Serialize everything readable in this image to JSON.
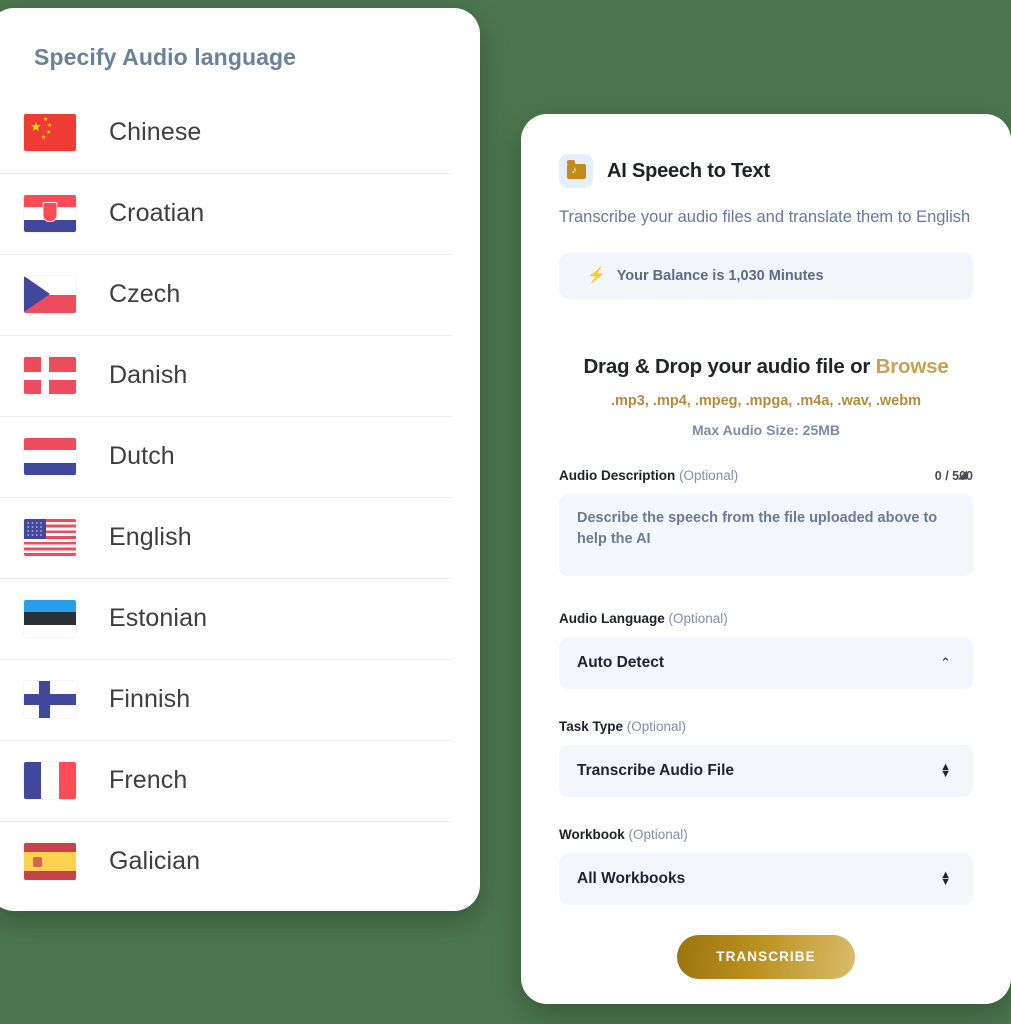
{
  "theme": {
    "page_background": "#4c774e",
    "card_background": "#ffffff",
    "accent_gold": "#b98f1c",
    "muted_blue": "#68789a",
    "input_background": "#f3f7fc"
  },
  "language_panel": {
    "title": "Specify Audio language",
    "languages": [
      {
        "name": "Chinese",
        "flag_icon": "flag-china-icon"
      },
      {
        "name": "Croatian",
        "flag_icon": "flag-croatia-icon"
      },
      {
        "name": "Czech",
        "flag_icon": "flag-czechia-icon"
      },
      {
        "name": "Danish",
        "flag_icon": "flag-denmark-icon"
      },
      {
        "name": "Dutch",
        "flag_icon": "flag-netherlands-icon"
      },
      {
        "name": "English",
        "flag_icon": "flag-usa-icon"
      },
      {
        "name": "Estonian",
        "flag_icon": "flag-estonia-icon"
      },
      {
        "name": "Finnish",
        "flag_icon": "flag-finland-icon"
      },
      {
        "name": "French",
        "flag_icon": "flag-france-icon"
      },
      {
        "name": "Galician",
        "flag_icon": "flag-spain-icon"
      }
    ]
  },
  "app_panel": {
    "icon": "audio-folder-icon",
    "title": "AI Speech to Text",
    "subtitle": "Transcribe your audio files and translate them to English",
    "balance": {
      "icon": "lightning-bolt-icon",
      "text": "Your Balance is 1,030 Minutes"
    },
    "dropzone": {
      "main_text": "Drag & Drop your audio file or ",
      "browse_label": "Browse",
      "formats": ".mp3, .mp4, .mpeg, .mpga, .m4a, .wav, .webm",
      "max_size": "Max Audio Size: 25MB"
    },
    "fields": {
      "audio_description": {
        "label": "Audio Description",
        "optional": " (Optional)",
        "counter": "0 / 500",
        "value": "",
        "placeholder": "Describe the speech from the file uploaded above to help the AI"
      },
      "audio_language": {
        "label": "Audio Language",
        "optional": " (Optional)",
        "value": "Auto Detect",
        "chevron_icon": "chevron-up-icon"
      },
      "task_type": {
        "label": "Task Type",
        "optional": " (Optional)",
        "value": "Transcribe Audio File",
        "chevron_icon": "up-down-arrows-icon"
      },
      "workbook": {
        "label": "Workbook",
        "optional": " (Optional)",
        "value": "All Workbooks",
        "chevron_icon": "up-down-arrows-icon"
      }
    },
    "submit_label": "TRANSCRIBE"
  }
}
